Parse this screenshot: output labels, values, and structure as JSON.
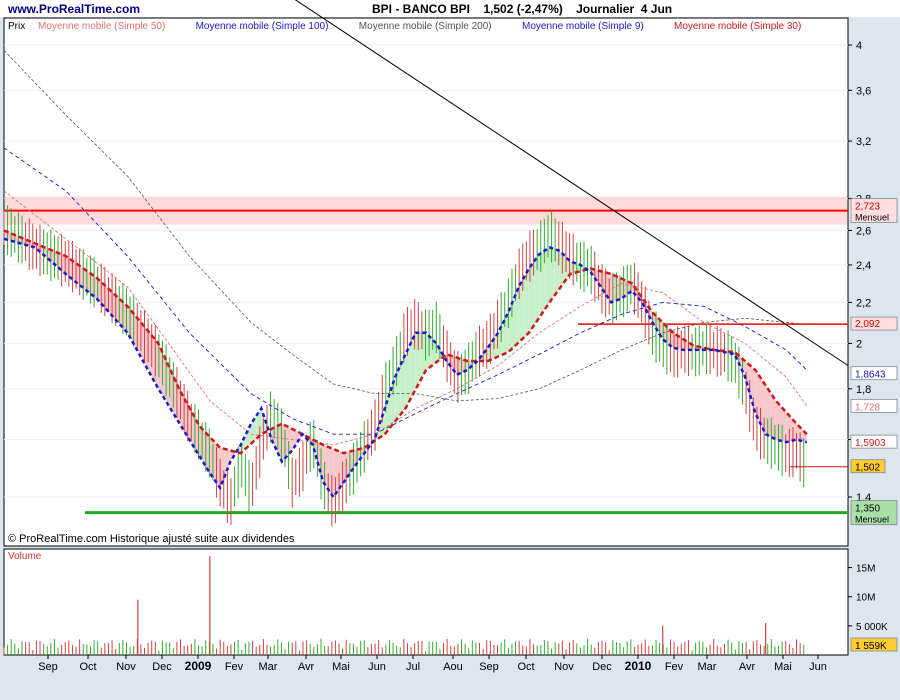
{
  "header": {
    "site": "www.ProRealTime.com",
    "instrument": "BPI - BANCO BPI",
    "last_change": "1,502 (-2,47%)",
    "period": "Journalier",
    "date": "4 Jun"
  },
  "legend": [
    {
      "label": "Prix",
      "color": "#000000"
    },
    {
      "label": "Moyenne mobile (Simple 50)",
      "color": "#e07070"
    },
    {
      "label": "Moyenne mobile (Simple 100)",
      "color": "#1a1acc"
    },
    {
      "label": "Moyenne mobile (Simple 200)",
      "color": "#555555"
    },
    {
      "label": "Moyenne mobile (Simple 9)",
      "color": "#1a1acc"
    },
    {
      "label": "Moyenne mobile (Simple 30)",
      "color": "#cc1a1a"
    }
  ],
  "footer_note": "© ProRealTime.com Historique ajusté suite aux dividendes",
  "volume_label": "Volume",
  "chart_data": {
    "type": "line",
    "price_axis": {
      "ticks": [
        "4",
        "3,6",
        "3,2",
        "2,8",
        "2,6",
        "2,4",
        "2,2",
        "2",
        "1,8",
        "1,6",
        "1,4"
      ],
      "log_scale": true
    },
    "x_ticks": [
      "Sep",
      "Oct",
      "Nov",
      "Dec",
      "2009",
      "Fev",
      "Mar",
      "Avr",
      "Mai",
      "Jun",
      "Jul",
      "Aou",
      "Sep",
      "Oct",
      "Nov",
      "Dec",
      "2010",
      "Fev",
      "Mar",
      "Avr",
      "Mai",
      "Jun"
    ],
    "price": {
      "points": [
        [
          0,
          2.62
        ],
        [
          3,
          2.5
        ],
        [
          6,
          2.42
        ],
        [
          9,
          2.3
        ],
        [
          12,
          2.15
        ],
        [
          15,
          1.95
        ],
        [
          18,
          1.68
        ],
        [
          20,
          1.55
        ],
        [
          21,
          1.45
        ],
        [
          22,
          1.38
        ],
        [
          23,
          1.52
        ],
        [
          24,
          1.42
        ],
        [
          25,
          1.58
        ],
        [
          26,
          1.7
        ],
        [
          27,
          1.62
        ],
        [
          28,
          1.45
        ],
        [
          29,
          1.5
        ],
        [
          30,
          1.6
        ],
        [
          31,
          1.45
        ],
        [
          32,
          1.38
        ],
        [
          34,
          1.5
        ],
        [
          36,
          1.65
        ],
        [
          37,
          1.8
        ],
        [
          38,
          1.9
        ],
        [
          39,
          2.05
        ],
        [
          40,
          2.1
        ],
        [
          41,
          2.04
        ],
        [
          42,
          2.08
        ],
        [
          43,
          1.95
        ],
        [
          44,
          1.85
        ],
        [
          45,
          1.88
        ],
        [
          46,
          1.96
        ],
        [
          47,
          2.0
        ],
        [
          48,
          2.1
        ],
        [
          49,
          2.2
        ],
        [
          50,
          2.35
        ],
        [
          51,
          2.45
        ],
        [
          52,
          2.5
        ],
        [
          53,
          2.58
        ],
        [
          54,
          2.52
        ],
        [
          55,
          2.45
        ],
        [
          56,
          2.4
        ],
        [
          57,
          2.38
        ],
        [
          58,
          2.28
        ],
        [
          59,
          2.22
        ],
        [
          60,
          2.25
        ],
        [
          61,
          2.3
        ],
        [
          62,
          2.2
        ],
        [
          63,
          2.05
        ],
        [
          64,
          2.0
        ],
        [
          65,
          1.95
        ],
        [
          66,
          1.98
        ],
        [
          67,
          1.96
        ],
        [
          68,
          1.98
        ],
        [
          69,
          1.97
        ],
        [
          70,
          1.96
        ],
        [
          71,
          1.92
        ],
        [
          72,
          1.8
        ],
        [
          73,
          1.65
        ],
        [
          74,
          1.6
        ],
        [
          75,
          1.58
        ],
        [
          76,
          1.55
        ],
        [
          77,
          1.56
        ],
        [
          78,
          1.5
        ]
      ],
      "last": "1,502"
    },
    "sma_9": {
      "points": [
        [
          0,
          2.55
        ],
        [
          3,
          2.5
        ],
        [
          6,
          2.35
        ],
        [
          9,
          2.22
        ],
        [
          12,
          2.05
        ],
        [
          15,
          1.8
        ],
        [
          18,
          1.6
        ],
        [
          20,
          1.48
        ],
        [
          21,
          1.43
        ],
        [
          22,
          1.52
        ],
        [
          23,
          1.58
        ],
        [
          24,
          1.66
        ],
        [
          25,
          1.72
        ],
        [
          26,
          1.6
        ],
        [
          27,
          1.52
        ],
        [
          28,
          1.56
        ],
        [
          29,
          1.62
        ],
        [
          30,
          1.58
        ],
        [
          31,
          1.45
        ],
        [
          32,
          1.4
        ],
        [
          34,
          1.5
        ],
        [
          36,
          1.6
        ],
        [
          37,
          1.72
        ],
        [
          38,
          1.85
        ],
        [
          39,
          1.95
        ],
        [
          40,
          2.05
        ],
        [
          41,
          2.05
        ],
        [
          42,
          2.0
        ],
        [
          43,
          1.92
        ],
        [
          44,
          1.86
        ],
        [
          45,
          1.88
        ],
        [
          46,
          1.92
        ],
        [
          47,
          1.98
        ],
        [
          48,
          2.05
        ],
        [
          49,
          2.15
        ],
        [
          50,
          2.28
        ],
        [
          51,
          2.38
        ],
        [
          52,
          2.46
        ],
        [
          53,
          2.5
        ],
        [
          54,
          2.48
        ],
        [
          55,
          2.42
        ],
        [
          56,
          2.4
        ],
        [
          57,
          2.36
        ],
        [
          58,
          2.28
        ],
        [
          59,
          2.2
        ],
        [
          60,
          2.22
        ],
        [
          61,
          2.26
        ],
        [
          62,
          2.2
        ],
        [
          63,
          2.1
        ],
        [
          64,
          2.02
        ],
        [
          65,
          1.98
        ],
        [
          66,
          1.97
        ],
        [
          67,
          1.97
        ],
        [
          68,
          1.97
        ],
        [
          69,
          1.97
        ],
        [
          70,
          1.96
        ],
        [
          71,
          1.95
        ],
        [
          72,
          1.85
        ],
        [
          73,
          1.7
        ],
        [
          74,
          1.62
        ],
        [
          75,
          1.6
        ],
        [
          76,
          1.59
        ],
        [
          77,
          1.6
        ],
        [
          78,
          1.59
        ]
      ]
    },
    "sma_30": {
      "points": [
        [
          0,
          2.6
        ],
        [
          6,
          2.45
        ],
        [
          9,
          2.33
        ],
        [
          12,
          2.18
        ],
        [
          15,
          2.0
        ],
        [
          17,
          1.8
        ],
        [
          19,
          1.65
        ],
        [
          21,
          1.57
        ],
        [
          23,
          1.55
        ],
        [
          25,
          1.62
        ],
        [
          27,
          1.66
        ],
        [
          29,
          1.62
        ],
        [
          31,
          1.58
        ],
        [
          33,
          1.55
        ],
        [
          35,
          1.57
        ],
        [
          37,
          1.62
        ],
        [
          39,
          1.72
        ],
        [
          41,
          1.88
        ],
        [
          43,
          1.95
        ],
        [
          45,
          1.92
        ],
        [
          47,
          1.92
        ],
        [
          49,
          1.96
        ],
        [
          51,
          2.05
        ],
        [
          53,
          2.2
        ],
        [
          55,
          2.35
        ],
        [
          57,
          2.38
        ],
        [
          59,
          2.35
        ],
        [
          61,
          2.3
        ],
        [
          63,
          2.15
        ],
        [
          65,
          2.05
        ],
        [
          67,
          1.99
        ],
        [
          69,
          1.97
        ],
        [
          71,
          1.96
        ],
        [
          73,
          1.88
        ],
        [
          75,
          1.75
        ],
        [
          77,
          1.66
        ],
        [
          78,
          1.62
        ]
      ],
      "last": "1,5903"
    },
    "sma_50": {
      "points": [
        [
          0,
          2.85
        ],
        [
          6,
          2.55
        ],
        [
          12,
          2.28
        ],
        [
          16,
          2.0
        ],
        [
          20,
          1.75
        ],
        [
          24,
          1.62
        ],
        [
          28,
          1.6
        ],
        [
          32,
          1.58
        ],
        [
          36,
          1.62
        ],
        [
          40,
          1.72
        ],
        [
          44,
          1.8
        ],
        [
          48,
          1.9
        ],
        [
          52,
          2.05
        ],
        [
          56,
          2.18
        ],
        [
          60,
          2.3
        ],
        [
          64,
          2.25
        ],
        [
          68,
          2.1
        ],
        [
          72,
          2.0
        ],
        [
          76,
          1.85
        ],
        [
          78,
          1.73
        ]
      ],
      "last": "1,728"
    },
    "sma_100": {
      "points": [
        [
          0,
          3.15
        ],
        [
          6,
          2.85
        ],
        [
          12,
          2.45
        ],
        [
          18,
          2.05
        ],
        [
          24,
          1.78
        ],
        [
          28,
          1.68
        ],
        [
          32,
          1.62
        ],
        [
          36,
          1.62
        ],
        [
          40,
          1.7
        ],
        [
          44,
          1.78
        ],
        [
          48,
          1.86
        ],
        [
          52,
          1.95
        ],
        [
          56,
          2.05
        ],
        [
          60,
          2.14
        ],
        [
          64,
          2.2
        ],
        [
          68,
          2.18
        ],
        [
          72,
          2.08
        ],
        [
          76,
          1.97
        ],
        [
          78,
          1.88
        ]
      ],
      "last": "1,8643"
    },
    "sma_200": {
      "points": [
        [
          0,
          3.95
        ],
        [
          6,
          3.4
        ],
        [
          12,
          2.95
        ],
        [
          18,
          2.45
        ],
        [
          24,
          2.1
        ],
        [
          28,
          1.95
        ],
        [
          32,
          1.82
        ],
        [
          36,
          1.78
        ],
        [
          40,
          1.78
        ],
        [
          44,
          1.75
        ],
        [
          48,
          1.76
        ],
        [
          52,
          1.8
        ],
        [
          56,
          1.88
        ],
        [
          60,
          1.97
        ],
        [
          64,
          2.05
        ],
        [
          68,
          2.1
        ],
        [
          72,
          2.12
        ],
        [
          76,
          2.1
        ],
        [
          78,
          2.09
        ]
      ],
      "last": "2,092"
    },
    "trendline": {
      "from": [
        27.5,
        4.5
      ],
      "to": [
        82,
        1.9
      ]
    },
    "levels": [
      {
        "value": 2.723,
        "label_top": "2,723",
        "label_bottom": "Mensuel",
        "color": "#ff0000"
      },
      {
        "value": 1.35,
        "label_top": "1,350",
        "label_bottom": "Mensuel",
        "color": "#22aa22"
      },
      {
        "value": 2.092,
        "label_top": "2,092",
        "color": "#ff0000"
      }
    ],
    "last_price_label": "1,502",
    "volume": {
      "axis_ticks": [
        "15M",
        "10M",
        "5 000K"
      ],
      "last": "1 559K",
      "spikes": [
        [
          20,
          17
        ],
        [
          13,
          9.5
        ],
        [
          64,
          5
        ],
        [
          74,
          5.5
        ]
      ]
    }
  }
}
